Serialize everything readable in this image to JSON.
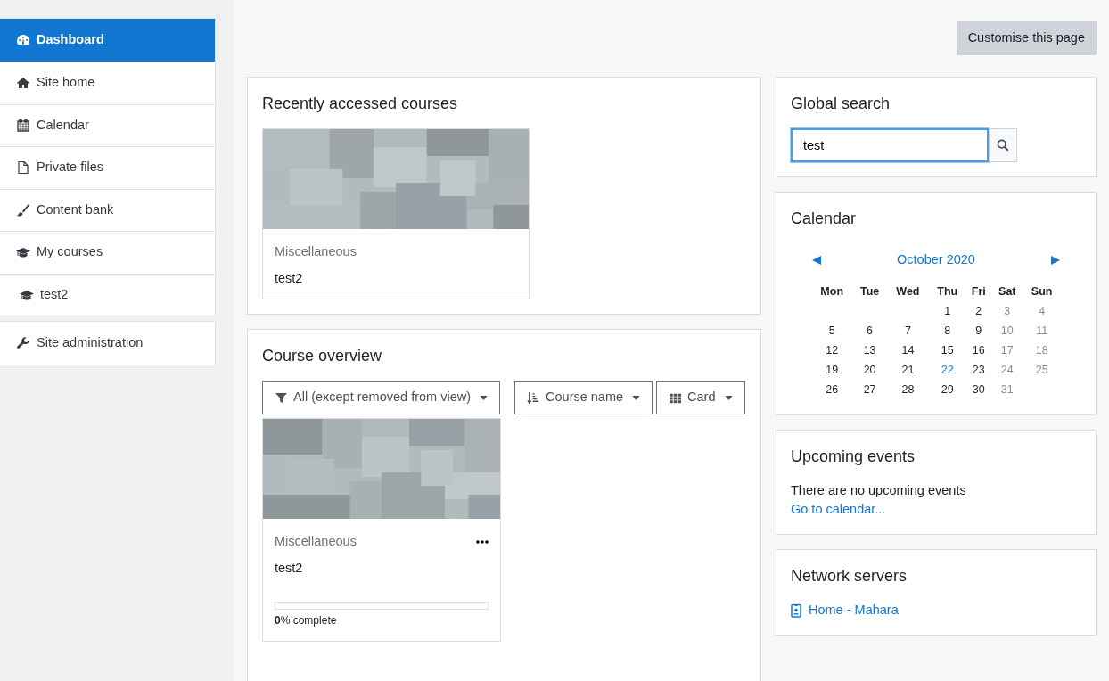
{
  "sidebar": {
    "groups": [
      {
        "items": [
          {
            "label": "Dashboard",
            "selected": true
          },
          {
            "label": "Site home",
            "selected": false
          },
          {
            "label": "Calendar",
            "selected": false
          },
          {
            "label": "Private files",
            "selected": false
          },
          {
            "label": "Content bank",
            "selected": false
          },
          {
            "label": "My courses",
            "selected": false,
            "children": [
              {
                "label": "test2",
                "selected": false
              }
            ]
          }
        ]
      },
      {
        "items": [
          {
            "label": "Site administration",
            "selected": false
          }
        ]
      }
    ]
  },
  "header": {
    "button": "Customise this page"
  },
  "recent": {
    "title": "Recently accessed courses",
    "courses": [
      {
        "category": "Miscellaneous",
        "name": "test2"
      }
    ]
  },
  "overview": {
    "title": "Course overview",
    "filters": [
      "All (except removed from view)",
      "Course name",
      "Card"
    ],
    "courses": [
      {
        "category": "Miscellaneous",
        "name": "test2",
        "level": 0,
        "progress": "**0**% complete"
      }
    ]
  },
  "search": {
    "title": "Global search",
    "value": "test"
  },
  "calendar": {
    "title": "Calendar",
    "month": "October 2020",
    "weekdays": [
      "Mon",
      "Tue",
      "Wed",
      "Thu",
      "Fri",
      "Sat",
      "Sun"
    ],
    "weeks": [
      [
        {
          "kind": "blank"
        },
        {
          "kind": "blank"
        },
        {
          "kind": "blank"
        },
        {
          "kind": "day",
          "day": "1",
          "weekend": false,
          "today": false
        },
        {
          "day": "2",
          "weekend": false,
          "today": false
        },
        {
          "day": "3",
          "weekend": true,
          "today": false
        },
        {
          "day": "4",
          "weekend": true,
          "today": false
        }
      ],
      [
        {
          "day": "5",
          "weekend": false,
          "today": false
        },
        {
          "day": "6",
          "weekend": false,
          "today": false
        },
        {
          "day": "7",
          "weekend": false,
          "today": false
        },
        {
          "day": "8",
          "weekend": false,
          "today": false
        },
        {
          "day": "9",
          "weekend": false,
          "today": false
        },
        {
          "day": "10",
          "weekend": true,
          "today": false
        },
        {
          "day": "11",
          "weekend": true,
          "today": false
        }
      ],
      [
        {
          "day": "12",
          "weekend": false,
          "today": false
        },
        {
          "day": "13",
          "weekend": false,
          "today": false
        },
        {
          "day": "14",
          "weekend": false,
          "today": false
        },
        {
          "day": "15",
          "weekend": false,
          "today": false
        },
        {
          "day": "16",
          "weekend": false,
          "today": false
        },
        {
          "day": "17",
          "weekend": true,
          "today": false
        },
        {
          "day": "18",
          "weekend": true,
          "today": false
        }
      ],
      [
        {
          "day": "19",
          "weekend": false,
          "today": false
        },
        {
          "day": "20",
          "weekend": false,
          "today": false
        },
        {
          "day": "21",
          "weekend": false,
          "today": false
        },
        {
          "day": "22",
          "weekend": false,
          "today": true
        },
        {
          "day": "23",
          "weekend": false,
          "today": false
        },
        {
          "day": "24",
          "weekend": true,
          "today": false
        },
        {
          "day": "25",
          "weekend": true,
          "today": false
        }
      ],
      [
        {
          "day": "26",
          "weekend": false,
          "today": false
        },
        {
          "day": "27",
          "weekend": false,
          "today": false
        },
        {
          "day": "28",
          "weekend": false,
          "today": false
        },
        {
          "day": "29",
          "weekend": false,
          "today": false
        },
        {
          "day": "30",
          "weekend": false,
          "today": false
        },
        {
          "day": "31",
          "weekend": true,
          "today": false
        }
      ]
    ]
  },
  "upcoming": {
    "title": "Upcoming events",
    "message": "There are no upcoming events",
    "link": "Go to calendar..."
  },
  "network": {
    "title": "Network servers",
    "links": [
      "Home - Mahara"
    ]
  }
}
